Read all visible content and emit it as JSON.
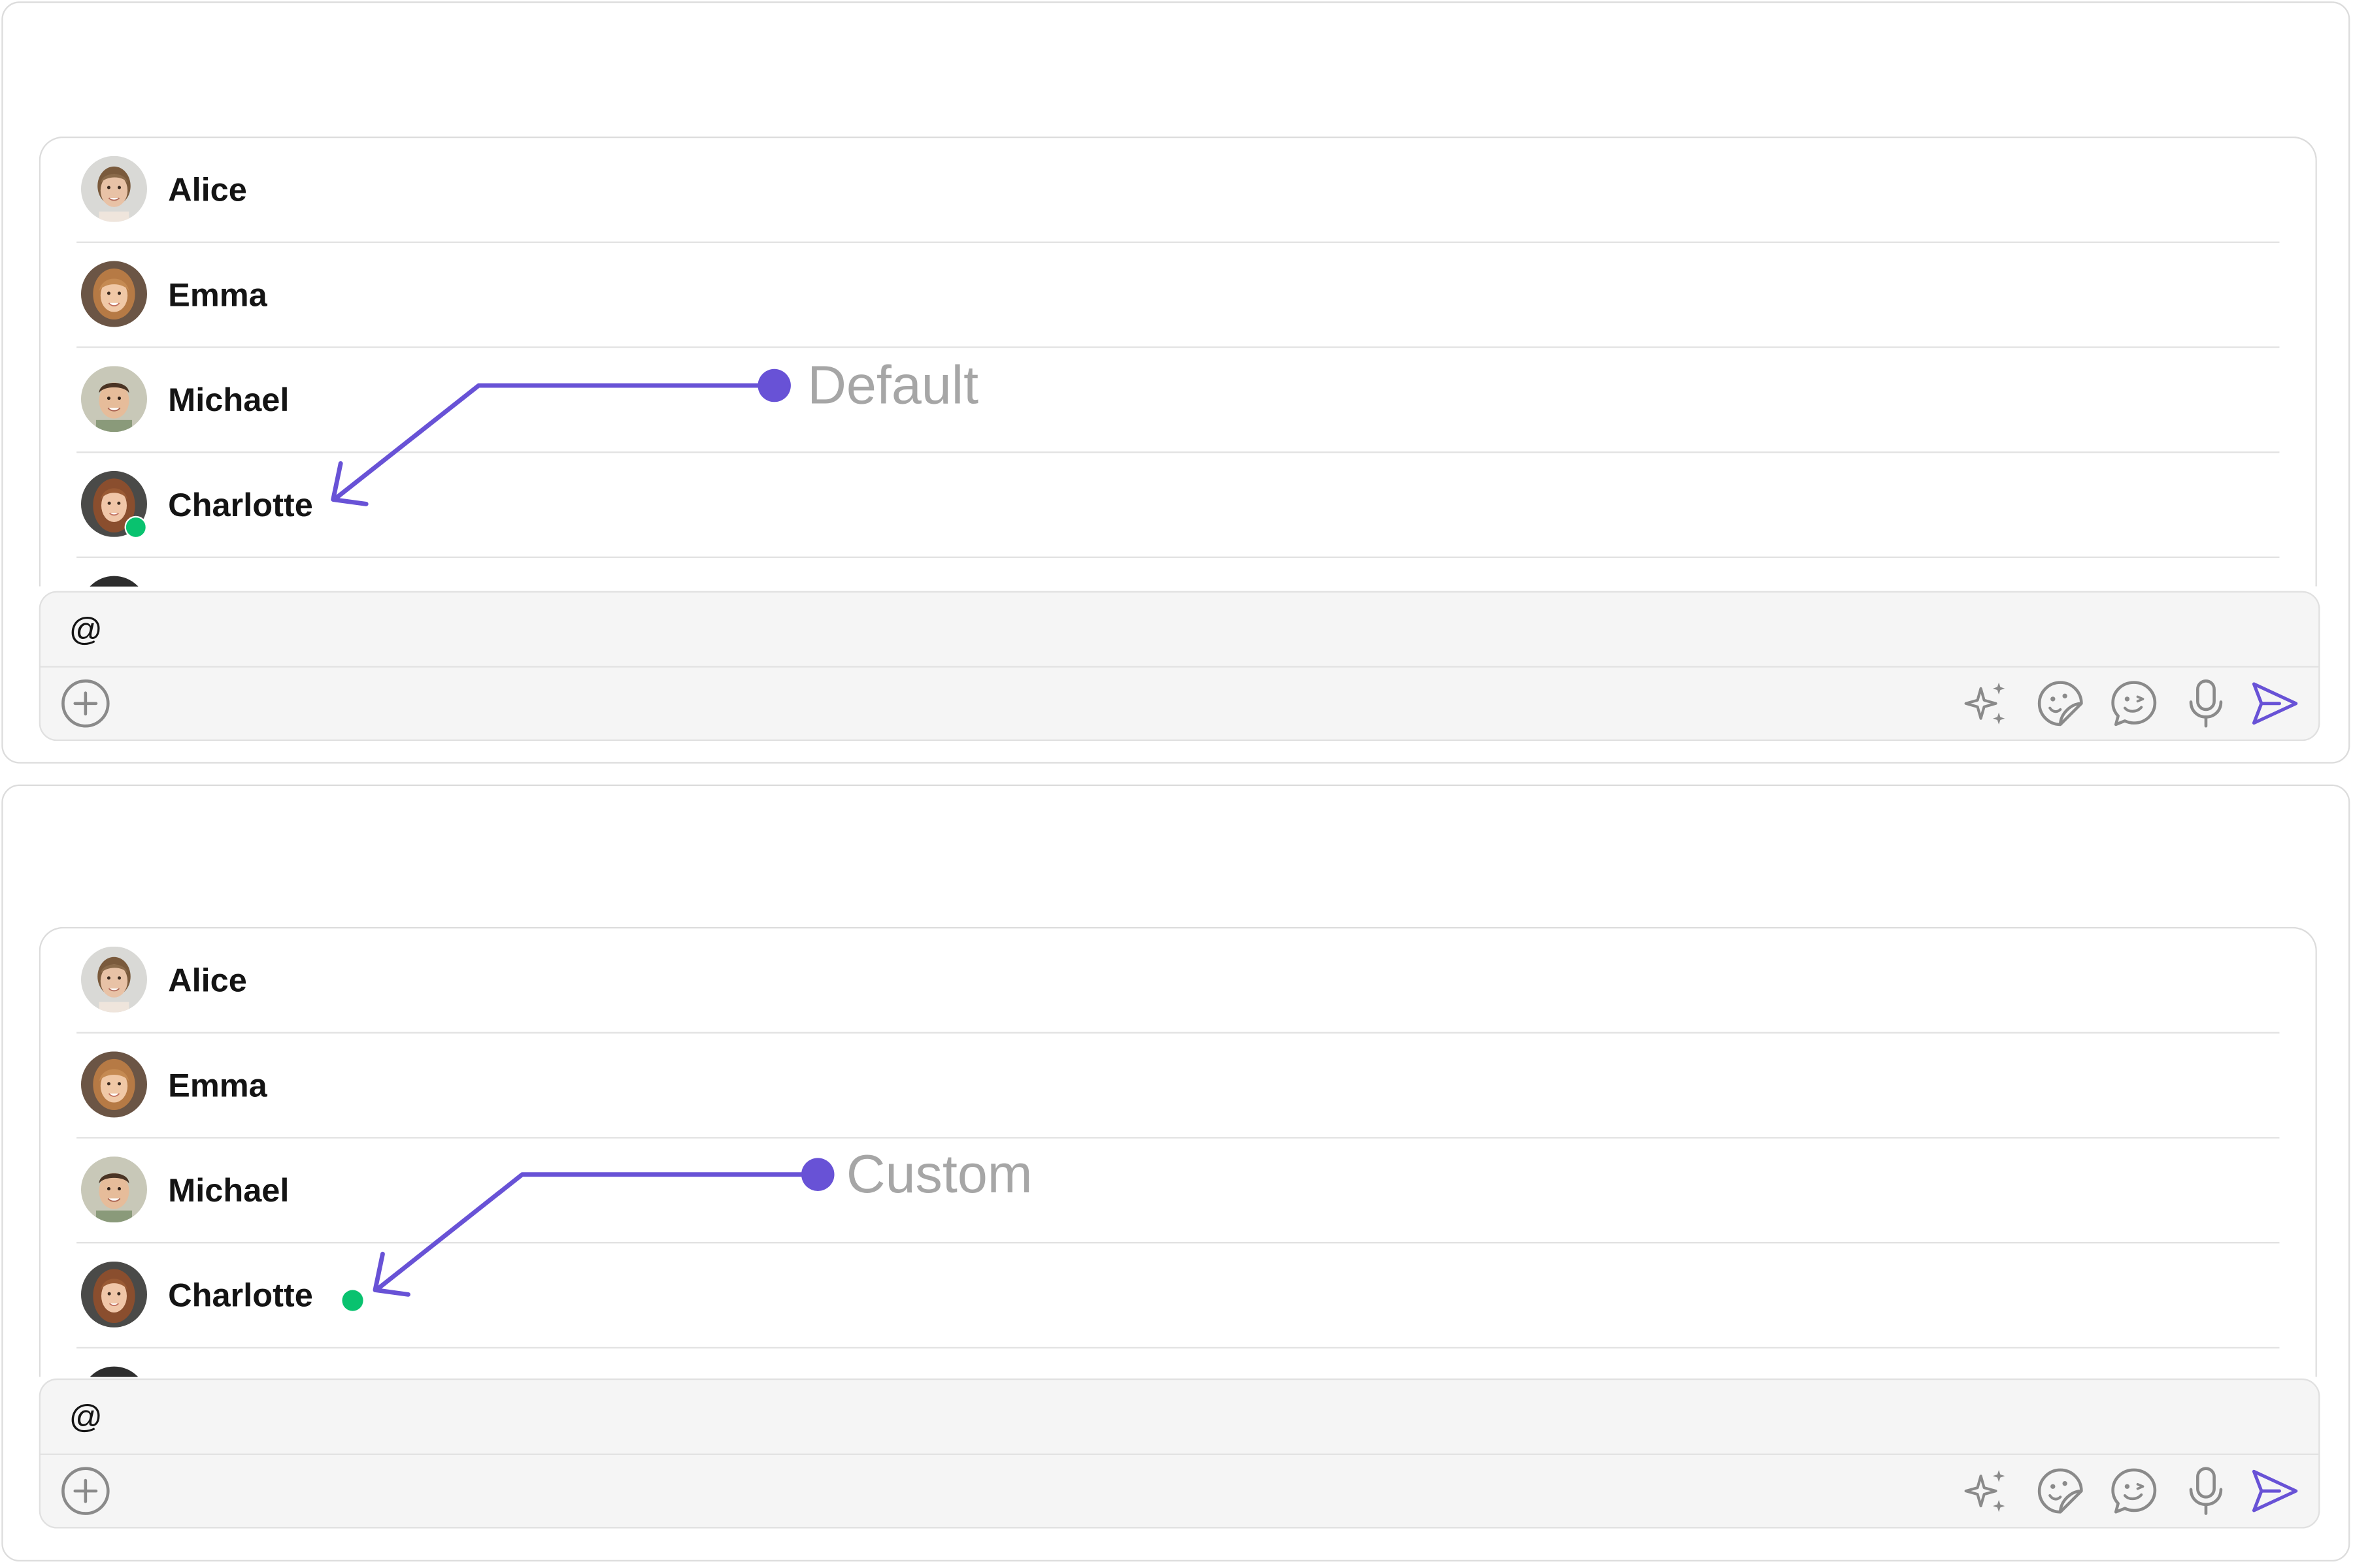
{
  "colors": {
    "accent": "#6852d6",
    "online": "#09c26f",
    "annotation_text": "#a6a6a6"
  },
  "panels": [
    {
      "annotation": "Default",
      "status_indicator": "avatar-badge",
      "users": [
        {
          "name": "Alice"
        },
        {
          "name": "Emma"
        },
        {
          "name": "Michael"
        },
        {
          "name": "Charlotte",
          "online": true
        }
      ],
      "composer": {
        "input_value": "@",
        "icons": [
          "add-icon",
          "ai-sparkle-icon",
          "sticker-icon",
          "emoji-icon",
          "microphone-icon",
          "send-icon"
        ]
      }
    },
    {
      "annotation": "Custom",
      "status_indicator": "dot-after-name",
      "users": [
        {
          "name": "Alice"
        },
        {
          "name": "Emma"
        },
        {
          "name": "Michael"
        },
        {
          "name": "Charlotte",
          "online": true
        }
      ],
      "composer": {
        "input_value": "@",
        "icons": [
          "add-icon",
          "ai-sparkle-icon",
          "sticker-icon",
          "emoji-icon",
          "microphone-icon",
          "send-icon"
        ]
      }
    }
  ]
}
